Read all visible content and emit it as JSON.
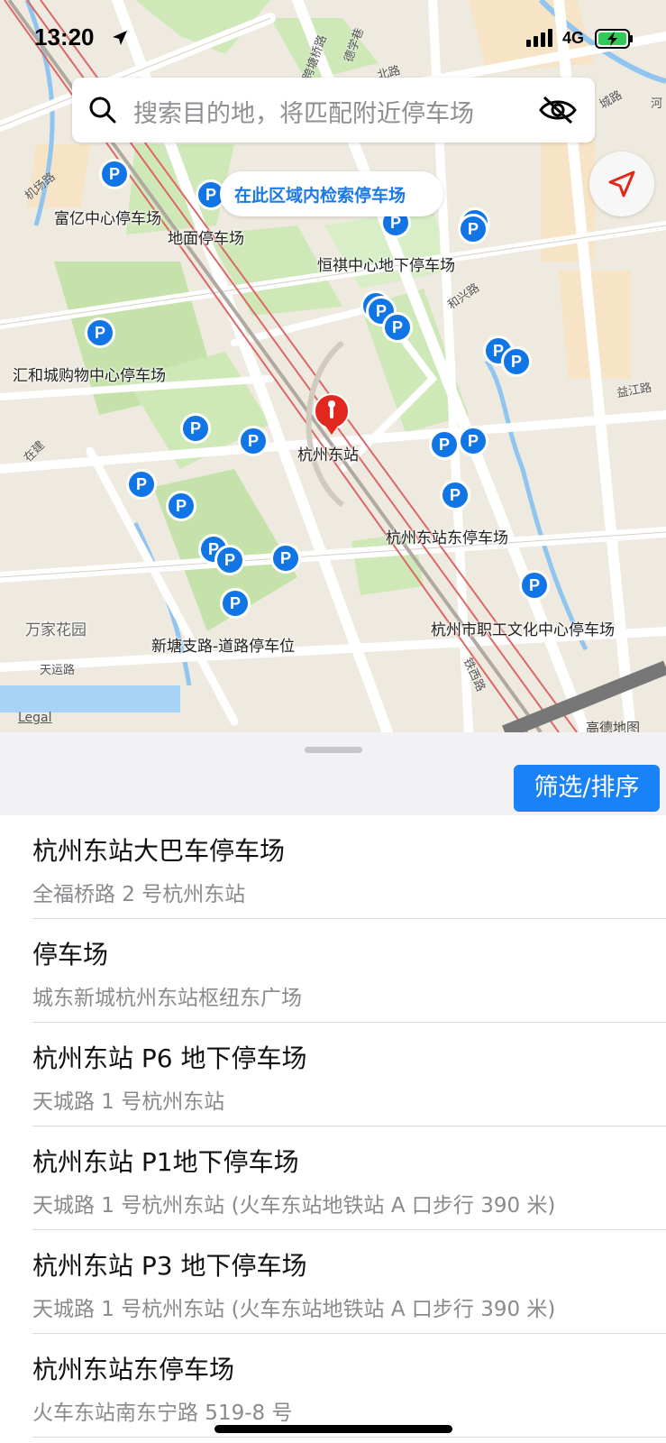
{
  "status": {
    "time": "13:20",
    "network": "4G"
  },
  "search": {
    "placeholder": "搜索目的地，将匹配附近停车场"
  },
  "map": {
    "area_search_label": "在此区域内检索停车场",
    "station_label": "杭州东站",
    "legal": "Legal",
    "brand": "高德地图",
    "pin_label": "P",
    "parking_labels": [
      "富亿中心停车场",
      "地面停车场",
      "恒祺中心地下停车场",
      "汇和城购物中心停车场",
      "杭州东站东停车场",
      "杭州市职工文化中心停车场",
      "新塘支路-道路停车位",
      "万家花园"
    ],
    "road_labels": [
      "机场路",
      "跨塘桥路",
      "德学巷",
      "北路",
      "城路",
      "和兴路",
      "益江路",
      "天运路",
      "铁西路",
      "在建",
      "河"
    ]
  },
  "sheet": {
    "filter_label": "筛选/排序"
  },
  "results": [
    {
      "name": "杭州东站大巴车停车场",
      "address": "全福桥路 2 号杭州东站"
    },
    {
      "name": "停车场",
      "address": "城东新城杭州东站枢纽东广场"
    },
    {
      "name": "杭州东站 P6 地下停车场",
      "address": "天城路 1 号杭州东站"
    },
    {
      "name": "杭州东站 P1地下停车场",
      "address": "天城路 1 号杭州东站 (火车东站地铁站 A 口步行 390 米)"
    },
    {
      "name": "杭州东站 P3 地下停车场",
      "address": "天城路 1 号杭州东站 (火车东站地铁站 A 口步行 390 米)"
    },
    {
      "name": "杭州东站东停车场",
      "address": "火车东站南东宁路 519-8 号"
    }
  ],
  "colors": {
    "accent": "#1a82f7",
    "pin": "#1275e6",
    "station_pin": "#e0281e",
    "locate_arrow": "#e0281e"
  }
}
